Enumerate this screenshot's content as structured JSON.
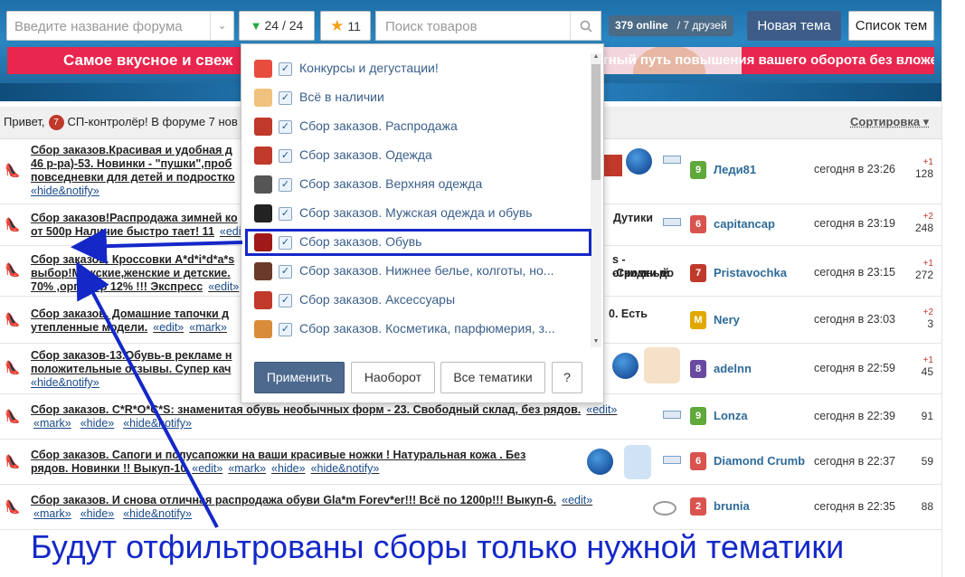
{
  "header": {
    "forum_placeholder": "Введите название форума",
    "filter_label": "24 / 24",
    "favorites_count": "11",
    "search_placeholder": "Поиск товаров",
    "online_label": "379 online",
    "friends_label": "/ 7 друзей",
    "new_topic_label": "Новая тема",
    "topic_list_label": "Список тем",
    "banner_left": "Самое вкусное и свеж",
    "banner_right": "остный путь повышения вашего оборота без вложений!"
  },
  "greeting": {
    "text_before": "Привет,",
    "text_after": "СП-контролёр! В форуме 7 нов",
    "sort_label": "Сортировка ▾"
  },
  "dropdown": {
    "items": [
      {
        "label": "Конкурсы и дегустации!",
        "icon": "pinwheel-icon",
        "color": "#e84c3d"
      },
      {
        "label": "Всё в наличии",
        "icon": "thumbs-up-icon",
        "color": "#f1c27d"
      },
      {
        "label": "Сбор заказов. Распродажа",
        "icon": "sale-tag-icon",
        "color": "#c0392b"
      },
      {
        "label": "Сбор заказов. Одежда",
        "icon": "dress-icon",
        "color": "#c0392b"
      },
      {
        "label": "Сбор заказов. Верхняя одежда",
        "icon": "coat-icon",
        "color": "#555555"
      },
      {
        "label": "Сбор заказов. Мужская одежда и обувь",
        "icon": "suit-icon",
        "color": "#222222"
      },
      {
        "label": "Сбор заказов. Обувь",
        "icon": "high-heel-icon",
        "color": "#a01818"
      },
      {
        "label": "Сбор заказов. Нижнее белье, колготы, но...",
        "icon": "lingerie-icon",
        "color": "#6b3a2a"
      },
      {
        "label": "Сбор заказов. Аксессуары",
        "icon": "hat-icon",
        "color": "#c0392b"
      },
      {
        "label": "Сбор заказов. Косметика, парфюмерия, з...",
        "icon": "cosmetics-icon",
        "color": "#d98c3a"
      }
    ],
    "apply_label": "Применить",
    "invert_label": "Наоборот",
    "all_label": "Все тематики",
    "help_label": "?"
  },
  "topics": [
    {
      "line1": "Сбор заказов.Красивая и удобная д",
      "line2": "46 р-ра)-53. Новинки - \"пушки\",проб",
      "line3": "повседневки для детей и подростко",
      "tags": [
        "«hide&notify»"
      ],
      "rank": "9",
      "rank_color": "#5fa83a",
      "user": "Леди81",
      "time": "сегодня в 23:26",
      "delta": "+1",
      "count": "128"
    },
    {
      "line1": "Сбор заказов!Распродажа зимней ко",
      "line1_right": "Дутики",
      "line2": "от 500р Наличие быстро тает! 11",
      "tags": [
        "«edit»"
      ],
      "rank": "6",
      "rank_color": "#d9534f",
      "user": "capitancap",
      "time": "сегодня в 23:19",
      "delta": "+2",
      "count": "248"
    },
    {
      "line1": "Сбор заказов. Кроссовки A*d*i*d*a*s",
      "line1_right": "s - огромный",
      "line2": "выбор!Мужские,женские и детские.",
      "line2_right": "-Скидки до",
      "line3": "70% ,орг.сбор 12% !!! Экспресс",
      "tags": [
        "«edit»"
      ],
      "rank": "7",
      "rank_color": "#c0392b",
      "user": "Pristavochka",
      "time": "сегодня в 23:15",
      "delta": "+1",
      "count": "272"
    },
    {
      "line1": "Сбор заказов. Домашние тапочки д",
      "line1_right": "0. Есть",
      "line2": "утепленные модели.",
      "tags": [
        "«edit»",
        "«mark»"
      ],
      "rank": "M",
      "rank_color": "#e0a800",
      "user": "Nery",
      "time": "сегодня в 23:03",
      "delta": "+2",
      "count": "3"
    },
    {
      "line1": "Сбор заказов-13.Обувь-в рекламе н",
      "line2": "положительные отзывы. Супер кач",
      "tags": [
        "«hide&notify»"
      ],
      "rank": "8",
      "rank_color": "#6a4aa0",
      "user": "adelnn",
      "time": "сегодня в 22:59",
      "delta": "+1",
      "count": "45"
    },
    {
      "line1": "Сбор заказов. C*R*O*C*S: знаменитая обувь необычных форм - 23. Свободный склад, без рядов.",
      "tags": [
        "«edit»",
        "«mark»",
        "«hide»",
        "«hide&notify»"
      ],
      "rank": "9",
      "rank_color": "#5fa83a",
      "user": "Lonza",
      "time": "сегодня в 22:39",
      "delta": "",
      "count": "91"
    },
    {
      "line1": "Сбор заказов. Сапоги и полусапожки на ваши красивые ножки ! Натуральная кожа . Без",
      "line2": "рядов. Новинки !! Выкуп-10",
      "tags": [
        "«edit»",
        "«mark»",
        "«hide»",
        "«hide&notify»"
      ],
      "rank": "6",
      "rank_color": "#d9534f",
      "user": "Diamond Crumb",
      "time": "сегодня в 22:37",
      "delta": "",
      "count": "59"
    },
    {
      "line1": "Сбор заказов. И снова отличная распродажа обуви Gla*m Forev*er!!! Всё по 1200р!!! Выкуп-6.",
      "tags": [
        "«edit»",
        "«mark»",
        "«hide»",
        "«hide&notify»"
      ],
      "rank": "2",
      "rank_color": "#d9534f",
      "user": "brunia",
      "time": "сегодня в 22:35",
      "delta": "",
      "count": "88"
    }
  ],
  "annotation": {
    "caption": "Будут отфильтрованы сборы только нужной тематики",
    "color": "#1428c8"
  }
}
